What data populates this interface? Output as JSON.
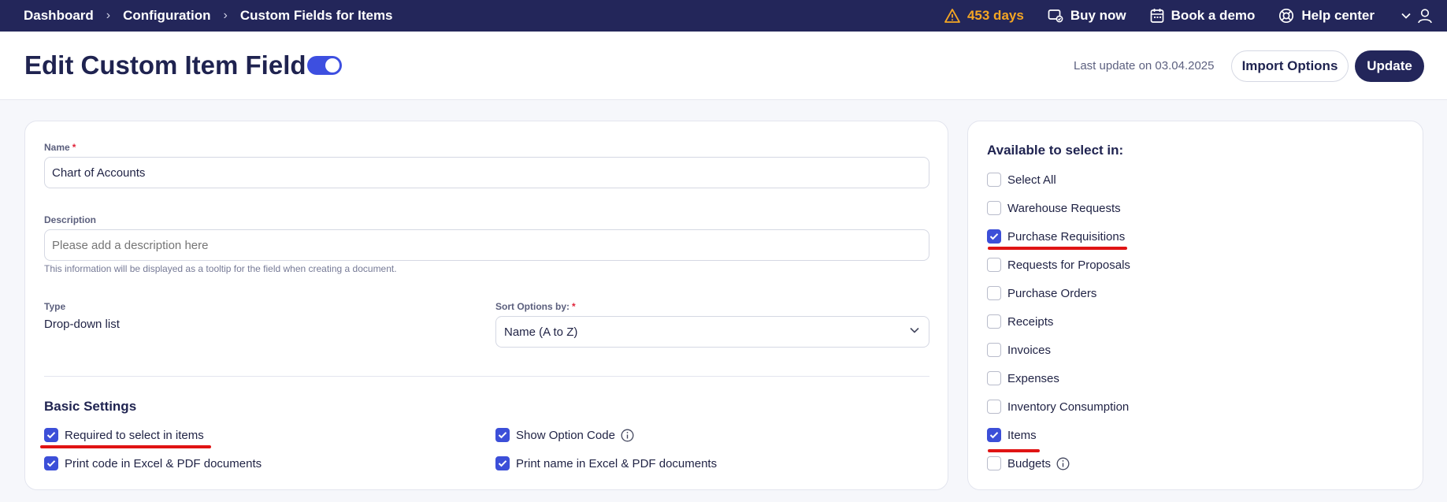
{
  "topbar": {
    "breadcrumbs": [
      "Dashboard",
      "Configuration",
      "Custom Fields for Items"
    ],
    "trial_days": "453 days",
    "buy_now": "Buy now",
    "book_demo": "Book a demo",
    "help_center": "Help center"
  },
  "header": {
    "title": "Edit Custom Item Field",
    "toggle_on": true,
    "last_update": "Last update on 03.04.2025",
    "import_options": "Import Options",
    "update": "Update"
  },
  "form": {
    "name_label": "Name",
    "required_mark": "*",
    "name_value": "Chart of Accounts",
    "description_label": "Description",
    "description_placeholder": "Please add a description here",
    "description_hint": "This information will be displayed as a tooltip for the field when creating a document.",
    "type_label": "Type",
    "type_value": "Drop-down list",
    "sort_label": "Sort Options by:",
    "sort_value": "Name (A to Z)"
  },
  "basic_settings": {
    "title": "Basic Settings",
    "options": [
      {
        "label": "Required to select in items",
        "checked": true
      },
      {
        "label": "Show Option Code",
        "checked": true,
        "info": true
      },
      {
        "label": "Print code in Excel & PDF documents",
        "checked": true
      },
      {
        "label": "Print name in Excel & PDF documents",
        "checked": true
      }
    ]
  },
  "available": {
    "title": "Available to select in:",
    "options": [
      {
        "label": "Select All",
        "checked": false
      },
      {
        "label": "Warehouse Requests",
        "checked": false
      },
      {
        "label": "Purchase Requisitions",
        "checked": true
      },
      {
        "label": "Requests for Proposals",
        "checked": false
      },
      {
        "label": "Purchase Orders",
        "checked": false
      },
      {
        "label": "Receipts",
        "checked": false
      },
      {
        "label": "Invoices",
        "checked": false
      },
      {
        "label": "Expenses",
        "checked": false
      },
      {
        "label": "Inventory Consumption",
        "checked": false
      },
      {
        "label": "Items",
        "checked": true
      },
      {
        "label": "Budgets",
        "checked": false,
        "info": true
      }
    ]
  },
  "colors": {
    "navy": "#23265a",
    "accent": "#3c4fd8",
    "warning": "#f5a623",
    "annotation_red": "#e01414"
  }
}
